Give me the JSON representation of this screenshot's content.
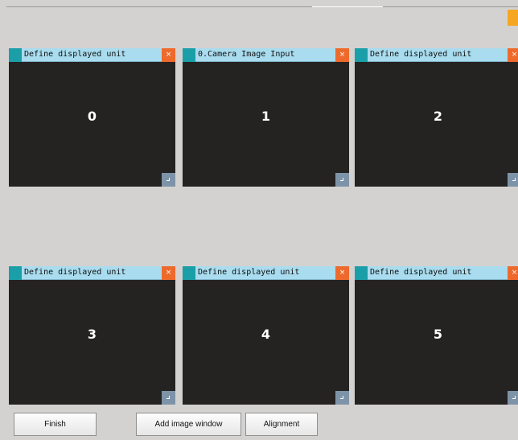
{
  "panels": [
    {
      "title": "Define displayed unit",
      "number": "0"
    },
    {
      "title": "0.Camera Image Input",
      "number": "1"
    },
    {
      "title": "Define displayed unit",
      "number": "2"
    },
    {
      "title": "Define displayed unit",
      "number": "3"
    },
    {
      "title": "Define displayed unit",
      "number": "4"
    },
    {
      "title": "Define displayed unit",
      "number": "5"
    }
  ],
  "panel_close_glyph": "×",
  "buttons": {
    "finish": "Finish",
    "add_image_window": "Add image window",
    "alignment": "Alignment"
  },
  "colors": {
    "title_bar": "#a9dcee",
    "tag": "#1a9fa8",
    "close": "#ee6a2c",
    "viewport": "#252222",
    "resize": "#7d93a8",
    "indicator": "#f5a623"
  }
}
